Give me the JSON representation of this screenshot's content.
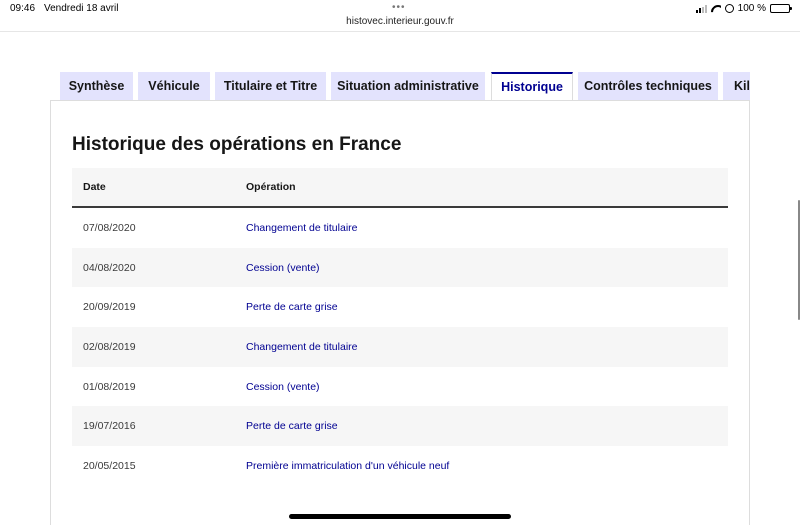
{
  "status_bar": {
    "time": "09:46",
    "date": "Vendredi 18 avril",
    "url": "histovec.interieur.gouv.fr",
    "battery": "100 %"
  },
  "tabs": [
    {
      "label": "Synthèse",
      "active": false
    },
    {
      "label": "Véhicule",
      "active": false
    },
    {
      "label": "Titulaire et Titre",
      "active": false
    },
    {
      "label": "Situation administrative",
      "active": false
    },
    {
      "label": "Historique",
      "active": true
    },
    {
      "label": "Contrôles techniques",
      "active": false
    },
    {
      "label": "Kil",
      "active": false
    }
  ],
  "panel": {
    "title": "Historique des opérations en France",
    "columns": {
      "date": "Date",
      "operation": "Opération"
    },
    "rows": [
      {
        "date": "07/08/2020",
        "operation": "Changement de titulaire"
      },
      {
        "date": "04/08/2020",
        "operation": "Cession (vente)"
      },
      {
        "date": "20/09/2019",
        "operation": "Perte de carte grise"
      },
      {
        "date": "02/08/2019",
        "operation": "Changement de titulaire"
      },
      {
        "date": "01/08/2019",
        "operation": "Cession (vente)"
      },
      {
        "date": "19/07/2016",
        "operation": "Perte de carte grise"
      },
      {
        "date": "20/05/2015",
        "operation": "Première immatriculation d'un véhicule neuf"
      }
    ]
  },
  "colors": {
    "accent": "#000091",
    "tab_inactive": "#e3e3fd",
    "row_alt": "#f6f6f6"
  }
}
